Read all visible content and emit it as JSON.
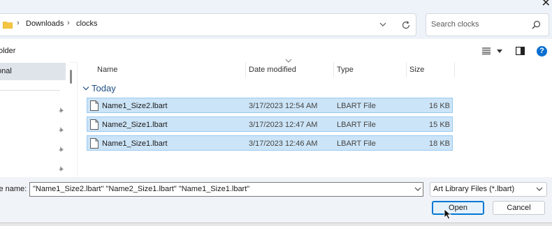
{
  "window": {
    "close_glyph": "✕"
  },
  "address": {
    "crumbs": [
      "Downloads",
      "clocks"
    ],
    "separator": "›"
  },
  "search": {
    "placeholder": "Search clocks"
  },
  "toolbar": {
    "new_folder_fragment": "older",
    "view_icon": "view-list-icon",
    "help_glyph": "?"
  },
  "nav": {
    "selected_fragment": "onal"
  },
  "columns": {
    "name": "Name",
    "date": "Date modified",
    "type": "Type",
    "size": "Size"
  },
  "group": {
    "label": "Today"
  },
  "files": [
    {
      "name": "Name1_Size2.lbart",
      "date": "3/17/2023 12:54 AM",
      "type": "LBART File",
      "size": "16 KB"
    },
    {
      "name": "Name2_Size1.lbart",
      "date": "3/17/2023 12:47 AM",
      "type": "LBART File",
      "size": "15 KB"
    },
    {
      "name": "Name1_Size1.lbart",
      "date": "3/17/2023 12:46 AM",
      "type": "LBART File",
      "size": "18 KB"
    }
  ],
  "footer": {
    "file_name_label": "le name:",
    "file_name_value": "\"Name1_Size2.lbart\" \"Name2_Size1.lbart\" \"Name1_Size1.lbart\"",
    "file_type": "Art Library Files (*.lbart)",
    "open_label": "Open",
    "cancel_label": "Cancel"
  },
  "colors": {
    "accent": "#0078d4",
    "selection": "#cce4f7",
    "group_header": "#1e4e84",
    "folder": "#f4c542"
  }
}
